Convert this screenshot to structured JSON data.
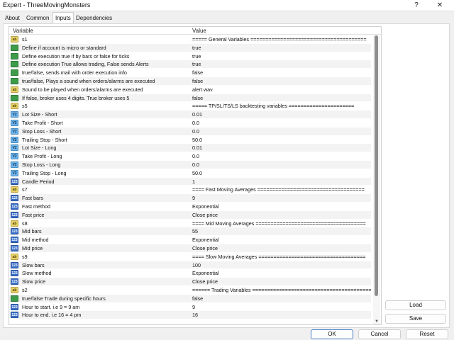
{
  "window": {
    "title": "Expert - ThreeMovingMonsters",
    "help_glyph": "?",
    "close_glyph": "✕"
  },
  "tabs": [
    {
      "label": "About"
    },
    {
      "label": "Common"
    },
    {
      "label": "Inputs",
      "active": true
    },
    {
      "label": "Dependencies"
    }
  ],
  "grid": {
    "col_variable": "Variable",
    "col_value": "Value",
    "rows": [
      {
        "icon": "ab",
        "variable": "s1",
        "value": "===== General Variables ======================================="
      },
      {
        "icon": "bool",
        "variable": "Define if account is micro or standard",
        "value": "true"
      },
      {
        "icon": "bool",
        "variable": "Define execution true if by bars or false for ticks",
        "value": "true"
      },
      {
        "icon": "bool",
        "variable": "Define execution True allows trading, False sends Alerts",
        "value": "true"
      },
      {
        "icon": "bool",
        "variable": "true/false, sends mail with order execution info",
        "value": "false"
      },
      {
        "icon": "bool",
        "variable": "true/false, Plays a sound when orders/alarms are executed",
        "value": "false"
      },
      {
        "icon": "ab",
        "variable": "Sound to be played when orders/alarms are executed",
        "value": "alert.wav"
      },
      {
        "icon": "bool",
        "variable": "If false, broker uses 4 digits. True broker uses 5",
        "value": "false"
      },
      {
        "icon": "ab",
        "variable": "s5",
        "value": "===== TP/SL/TS/LS backtesting variables ======================"
      },
      {
        "icon": "dbl",
        "variable": "Lot Size - Short",
        "value": "0.01"
      },
      {
        "icon": "dbl",
        "variable": "Take Profit - Short",
        "value": "0.0"
      },
      {
        "icon": "dbl",
        "variable": "Stop Loss - Short",
        "value": "0.0"
      },
      {
        "icon": "dbl",
        "variable": "Trailing Stop - Short",
        "value": "50.0"
      },
      {
        "icon": "dbl",
        "variable": "Lot Size - Long",
        "value": "0.01"
      },
      {
        "icon": "dbl",
        "variable": "Take Profit - Long",
        "value": "0.0"
      },
      {
        "icon": "dbl",
        "variable": "Stop Loss - Long",
        "value": "0.0"
      },
      {
        "icon": "dbl",
        "variable": "Trailing Stop - Long",
        "value": "50.0"
      },
      {
        "icon": "int",
        "variable": "Candle Period",
        "value": "1"
      },
      {
        "icon": "ab",
        "variable": "s7",
        "value": "==== Fast Moving Averages ===================================="
      },
      {
        "icon": "int",
        "variable": "Fast bars",
        "value": "9"
      },
      {
        "icon": "int",
        "variable": "Fast method",
        "value": "Exponential"
      },
      {
        "icon": "int",
        "variable": "Fast price",
        "value": "Close price"
      },
      {
        "icon": "ab",
        "variable": "s8",
        "value": "==== Mid Moving Averages ====================================="
      },
      {
        "icon": "int",
        "variable": "Mid bars",
        "value": "55"
      },
      {
        "icon": "int",
        "variable": "Mid method",
        "value": "Exponential"
      },
      {
        "icon": "int",
        "variable": "Mid price",
        "value": "Close price"
      },
      {
        "icon": "ab",
        "variable": "s9",
        "value": "==== Slow Moving Averages ===================================="
      },
      {
        "icon": "int",
        "variable": "Slow bars",
        "value": "100"
      },
      {
        "icon": "int",
        "variable": "Slow method",
        "value": "Exponential"
      },
      {
        "icon": "int",
        "variable": "Slow price",
        "value": "Close price"
      },
      {
        "icon": "ab",
        "variable": "s2",
        "value": "====== Trading Variables =========================================="
      },
      {
        "icon": "bool",
        "variable": "true/false Trade during specific hours",
        "value": "false"
      },
      {
        "icon": "int",
        "variable": "Hour to start. i.e 9 = 9 am",
        "value": "9"
      },
      {
        "icon": "int",
        "variable": "Hour to end. i.e 16 = 4 pm",
        "value": "16"
      }
    ]
  },
  "buttons": {
    "load": "Load",
    "save": "Save",
    "ok": "OK",
    "cancel": "Cancel",
    "reset": "Reset"
  },
  "icons": {
    "ab": "ab",
    "bool": "",
    "dbl": "V2",
    "int": "123"
  }
}
